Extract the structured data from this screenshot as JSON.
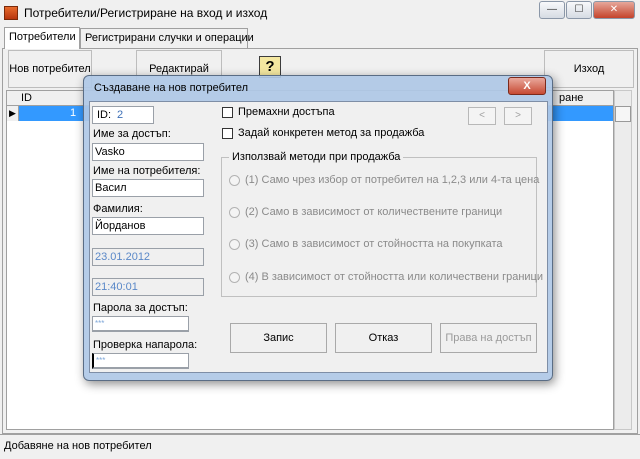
{
  "window": {
    "title": "Потребители/Регистриране на  вход и изход",
    "min_glyph": "—",
    "max_glyph": "☐",
    "close_glyph": "✕"
  },
  "tabs": [
    {
      "label": "Потребители"
    },
    {
      "label": "Регистрирани случки и операции"
    }
  ],
  "toolbar": {
    "new_user": "Нов потребител",
    "edit": "Редактирай",
    "help": "?",
    "exit": "Изход"
  },
  "grid": {
    "headers": [
      "ID",
      "ране"
    ],
    "rows": [
      {
        "indicator": "▶",
        "id": "1"
      }
    ]
  },
  "status": {
    "text": "Добавяне на нов потребител"
  },
  "dialog": {
    "title": "Създаване на нов потребител",
    "close_glyph": "X",
    "id_label": "ID:",
    "id_value": "2",
    "username_label": "Име за достъп:",
    "username_value": "Vasko",
    "name_label": "Име на потребителя:",
    "name_value": "Васил",
    "surname_label": "Фамилия:",
    "surname_value": "Йорданов",
    "date_value": "23.01.2012",
    "time_value": "21:40:01",
    "password_label": "Парола за достъп:",
    "password_value": "***",
    "confirm_label": "Проверка напарола:",
    "confirm_value": "***",
    "remove_access_label": "Премахни достъпа",
    "remove_access_checked": false,
    "specific_method_label": "Задай конкретен метод за продажба",
    "specific_method_checked": false,
    "prev_glyph": "<",
    "next_glyph": ">",
    "group_title": "Използвай методи при продажба",
    "methods": [
      {
        "label": "(1) Само чрез избор от потребител на 1,2,3 или 4-та цена"
      },
      {
        "label": "(2) Само в зависимост от количествените граници"
      },
      {
        "label": "(3) Само в зависимост от стойността на покупката"
      },
      {
        "label": "(4) В зависимост от стойността или количествени граници"
      }
    ],
    "save_button": "Запис",
    "cancel_button": "Отказ",
    "access_rights_button": "Права на достъп"
  }
}
